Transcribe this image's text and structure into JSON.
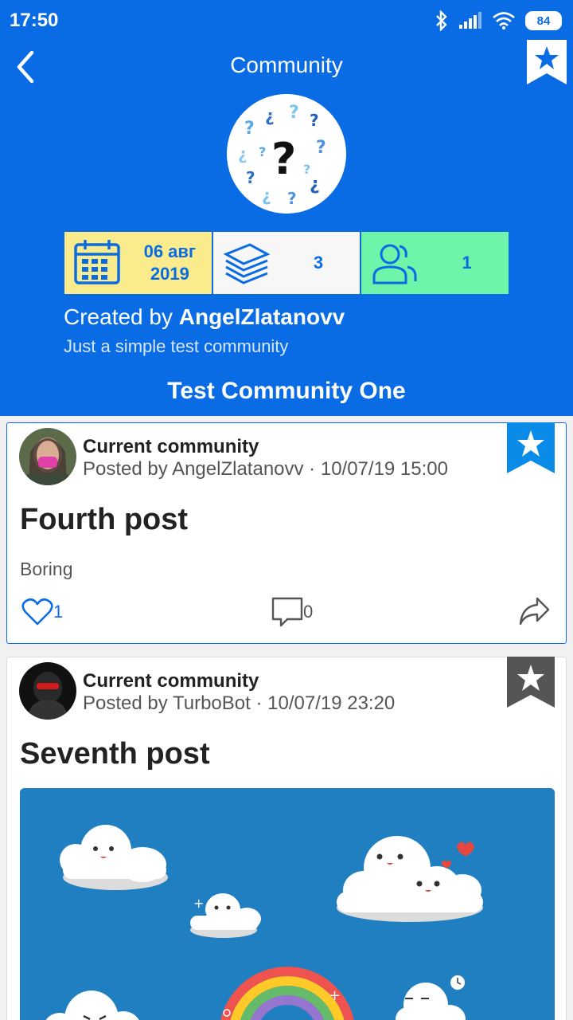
{
  "status": {
    "time": "17:50",
    "battery": "84"
  },
  "header": {
    "title": "Community"
  },
  "stats": {
    "date_day": "06 авг",
    "date_year": "2019",
    "posts": "3",
    "members": "1"
  },
  "community": {
    "created_prefix": "Created by ",
    "creator": "AngelZlatanovv",
    "description": "Just a simple test community",
    "name": "Test Community One"
  },
  "posts": [
    {
      "community": "Current community",
      "meta": "Posted by AngelZlatanovv · 10/07/19 15:00",
      "title": "Fourth post",
      "body": "Boring",
      "likes": "1",
      "comments": "0",
      "bookmark_color": "#0a8be8"
    },
    {
      "community": "Current community",
      "meta": "Posted by TurboBot · 10/07/19 23:20",
      "title": "Seventh post",
      "bookmark_color": "#555555"
    }
  ],
  "colors": {
    "primary": "#0a6ce4",
    "date": "#faeb8c",
    "members": "#6ff5a9"
  }
}
